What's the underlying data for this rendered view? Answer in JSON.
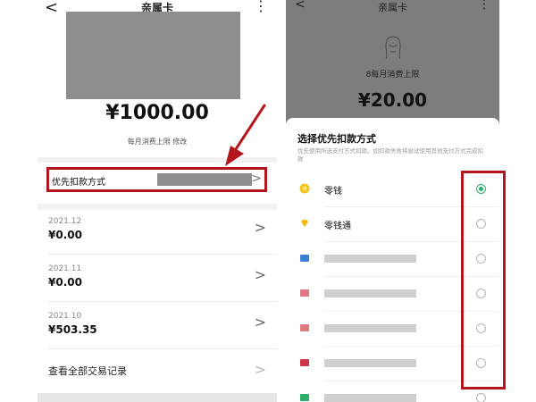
{
  "left": {
    "nav": {
      "back": "<",
      "title": "亲属卡",
      "more": "⋮"
    },
    "amount": "¥1000.00",
    "limit": "每月消费上限 修改",
    "pay_method": {
      "label": "优先扣款方式",
      "chevron": ">"
    },
    "records": [
      {
        "date": "2021.12",
        "amount": "¥0.00"
      },
      {
        "date": "2021.11",
        "amount": "¥0.00"
      },
      {
        "date": "2021.10",
        "amount": "¥503.35"
      }
    ],
    "view_all": "查看全部交易记录",
    "chevron": ">"
  },
  "right": {
    "nav": {
      "back": "<",
      "title": "亲属卡",
      "more": "⋮"
    },
    "limit": "8每月消费上限",
    "amount": "¥20.00",
    "sheet": {
      "title": "选择优先扣款方式",
      "desc": "优先使用所选支付方式扣款。如扣款失败将尝试使用其他支付方式完成扣款",
      "options": [
        {
          "name": "零钱",
          "icon": "coin-icon",
          "color": "#f5c518",
          "selected": true
        },
        {
          "name": "零钱通",
          "icon": "diamond-icon",
          "color": "#f5b800",
          "selected": false
        },
        {
          "name": "",
          "icon": "bank-card-icon",
          "color": "#3b7fd6",
          "selected": false
        },
        {
          "name": "",
          "icon": "bank-card-icon",
          "color": "#e07a80",
          "selected": false
        },
        {
          "name": "",
          "icon": "bank-card-icon",
          "color": "#e07a80",
          "selected": false
        },
        {
          "name": "",
          "icon": "bank-card-icon",
          "color": "#d0364b",
          "selected": false
        },
        {
          "name": "",
          "icon": "bank-card-icon",
          "color": "#2aae67",
          "selected": false
        }
      ]
    }
  },
  "colors": {
    "highlight": "#b3171d",
    "accent": "#2aae67"
  }
}
